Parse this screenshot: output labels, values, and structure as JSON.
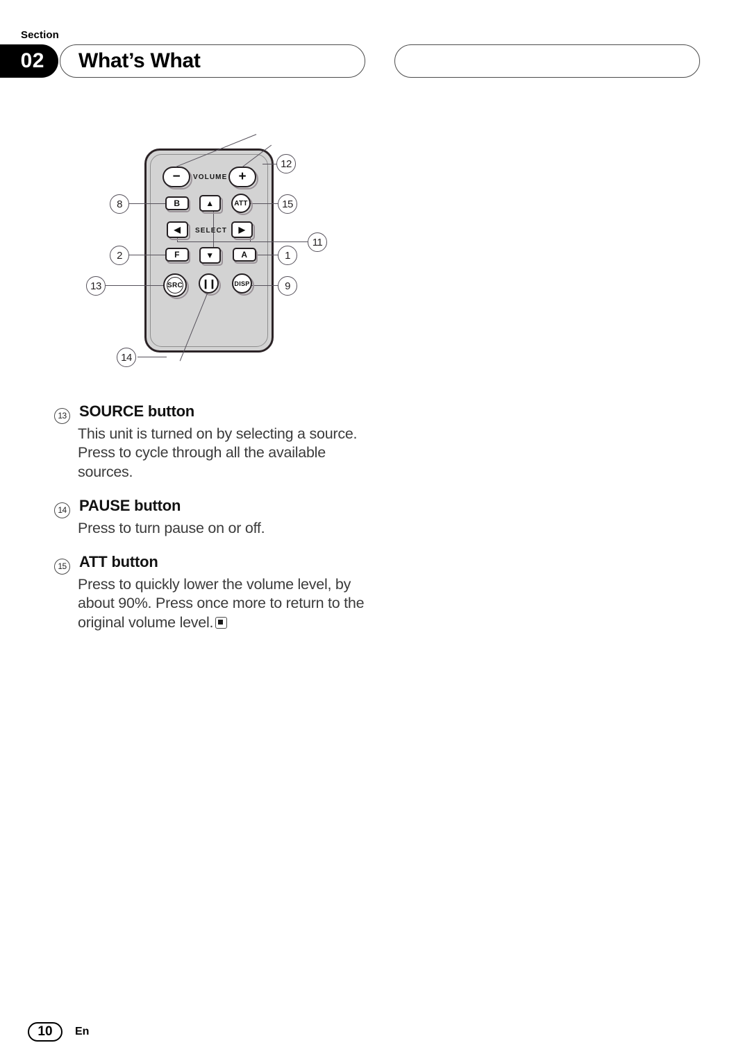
{
  "header": {
    "section_label": "Section",
    "section_number": "02",
    "title": "What’s What",
    "right_box_text": ""
  },
  "figure": {
    "caption": "",
    "device": "remote control",
    "keys": [
      {
        "id": "volume-minus",
        "label": "−",
        "shape": "pill"
      },
      {
        "id": "volume-label",
        "label": "VOLUME",
        "shape": "text"
      },
      {
        "id": "volume-plus",
        "label": "+",
        "shape": "pill"
      },
      {
        "id": "band-b",
        "label": "B",
        "shape": "rect"
      },
      {
        "id": "up",
        "label": "▲",
        "shape": "rect"
      },
      {
        "id": "att",
        "label": "ATT",
        "shape": "circle"
      },
      {
        "id": "left",
        "label": "◀",
        "shape": "rect"
      },
      {
        "id": "select-label",
        "label": "SELECT",
        "shape": "text"
      },
      {
        "id": "right",
        "label": "▶",
        "shape": "rect"
      },
      {
        "id": "function-f",
        "label": "F",
        "shape": "rect"
      },
      {
        "id": "down",
        "label": "▼",
        "shape": "rect"
      },
      {
        "id": "audio-a",
        "label": "A",
        "shape": "rect"
      },
      {
        "id": "src",
        "label": "SRC",
        "shape": "circle"
      },
      {
        "id": "pause",
        "label": "❙❙",
        "shape": "circle"
      },
      {
        "id": "disp",
        "label": "DISP",
        "shape": "circle"
      }
    ],
    "callouts": [
      {
        "id": "callout-12",
        "number": "12",
        "target": "volume buttons"
      },
      {
        "id": "callout-8",
        "number": "8",
        "target": "band button"
      },
      {
        "id": "callout-15",
        "number": "15",
        "target": "att button"
      },
      {
        "id": "callout-11",
        "number": "11",
        "target": "arrow buttons"
      },
      {
        "id": "callout-2",
        "number": "2",
        "target": "function button"
      },
      {
        "id": "callout-1",
        "number": "1",
        "target": "audio button"
      },
      {
        "id": "callout-13",
        "number": "13",
        "target": "source button"
      },
      {
        "id": "callout-9",
        "number": "9",
        "target": "display button"
      },
      {
        "id": "callout-14",
        "number": "14",
        "target": "pause button"
      }
    ]
  },
  "entries": [
    {
      "number": "13",
      "title": "SOURCE button",
      "body": "This unit is turned on by selecting a source. Press to cycle through all the available sources.",
      "endmark": false
    },
    {
      "number": "14",
      "title": "PAUSE button",
      "body": "Press to turn pause on or off.",
      "endmark": false
    },
    {
      "number": "15",
      "title": "ATT button",
      "body": "Press to quickly lower the volume level, by about 90%. Press once more to return to the original volume level.",
      "endmark": true
    }
  ],
  "footer": {
    "page_number": "10",
    "language": "En"
  },
  "colors": {
    "ink": "#1a1a1a",
    "body_text": "#3b3b3b",
    "remote_body": "#d3d3d3",
    "remote_outline": "#2b2326",
    "lead_line": "#55505a"
  }
}
